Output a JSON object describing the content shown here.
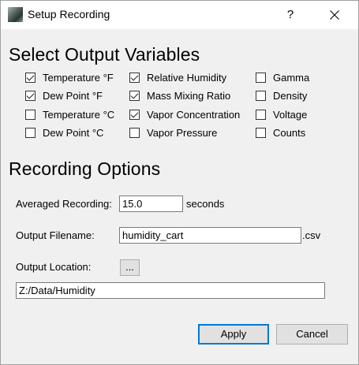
{
  "window": {
    "title": "Setup Recording",
    "help_label": "?"
  },
  "variables": {
    "heading": "Select Output Variables",
    "items": [
      {
        "label": "Temperature °F",
        "checked": true
      },
      {
        "label": "Dew Point °F",
        "checked": true
      },
      {
        "label": "Temperature °C",
        "checked": false
      },
      {
        "label": "Dew Point °C",
        "checked": false
      },
      {
        "label": "Relative Humidity",
        "checked": true
      },
      {
        "label": "Mass Mixing Ratio",
        "checked": true
      },
      {
        "label": "Vapor Concentration",
        "checked": true
      },
      {
        "label": "Vapor Pressure",
        "checked": false
      },
      {
        "label": "Gamma",
        "checked": false
      },
      {
        "label": "Density",
        "checked": false
      },
      {
        "label": "Voltage",
        "checked": false
      },
      {
        "label": "Counts",
        "checked": false
      }
    ]
  },
  "recording": {
    "heading": "Recording Options",
    "averaged_label": "Averaged Recording:",
    "averaged_value": "15.0",
    "averaged_unit": "seconds",
    "filename_label": "Output Filename:",
    "filename_value": "humidity_cart",
    "filename_ext": ".csv",
    "location_label": "Output Location:",
    "browse_label": "...",
    "location_value": "Z:/Data/Humidity"
  },
  "buttons": {
    "apply": "Apply",
    "cancel": "Cancel"
  }
}
